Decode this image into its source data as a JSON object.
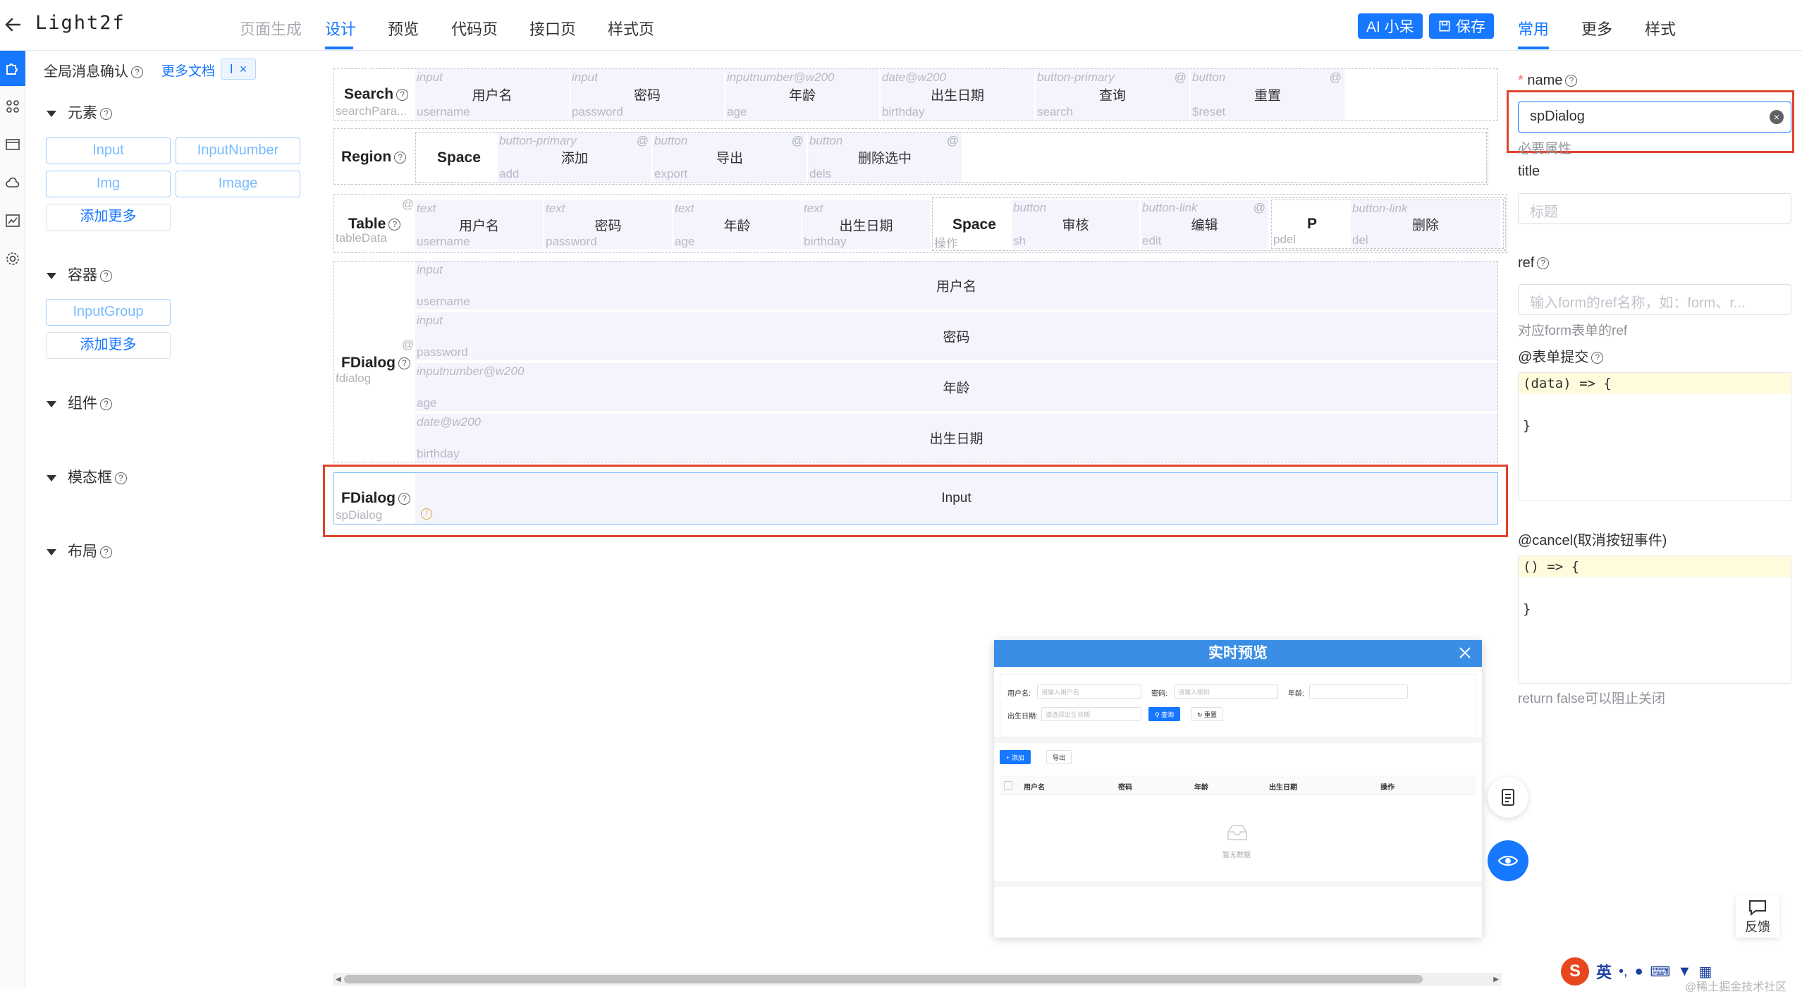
{
  "header": {
    "back_icon": "arrow-left-icon",
    "app_title": "Light2f",
    "tabs": [
      {
        "label": "页面生成",
        "state": "disabled"
      },
      {
        "label": "设计",
        "state": "active"
      },
      {
        "label": "预览",
        "state": "normal"
      },
      {
        "label": "代码页",
        "state": "normal"
      },
      {
        "label": "接口页",
        "state": "normal"
      },
      {
        "label": "样式页",
        "state": "normal"
      }
    ],
    "ai_button": "AI 小呆",
    "save_button": "保存",
    "accent_color": "#1677ff"
  },
  "left_panel": {
    "global_confirm": "全局消息确认",
    "more_docs": "更多文档",
    "tag_label": "I",
    "tag_close": "×",
    "sections": {
      "elements": {
        "title": "元素",
        "items": [
          "Input",
          "InputNumber",
          "Img",
          "Image"
        ],
        "add_more": "添加更多"
      },
      "containers": {
        "title": "容器",
        "items": [
          "InputGroup"
        ],
        "add_more": "添加更多"
      },
      "components": {
        "title": "组件"
      },
      "modals": {
        "title": "模态框"
      },
      "layout": {
        "title": "布局"
      }
    }
  },
  "canvas": {
    "search": {
      "label": "Search",
      "sub": "searchPara...",
      "cells": [
        {
          "tag": "input",
          "key": "username",
          "label": "用户名",
          "at": ""
        },
        {
          "tag": "input",
          "key": "password",
          "label": "密码",
          "at": ""
        },
        {
          "tag": "inputnumber@w200",
          "key": "age",
          "label": "年龄",
          "at": ""
        },
        {
          "tag": "date@w200",
          "key": "birthday",
          "label": "出生日期",
          "at": ""
        },
        {
          "tag": "button-primary",
          "key": "search",
          "label": "查询",
          "at": "@"
        },
        {
          "tag": "button",
          "key": "$reset",
          "label": "重置",
          "at": "@"
        }
      ]
    },
    "region": {
      "label": "Region",
      "space_label": "Space",
      "cells": [
        {
          "tag": "button-primary",
          "key": "add",
          "label": "添加",
          "at": "@"
        },
        {
          "tag": "button",
          "key": "export",
          "label": "导出",
          "at": "@"
        },
        {
          "tag": "button",
          "key": "dels",
          "label": "删除选中",
          "at": "@"
        }
      ]
    },
    "table": {
      "label": "Table",
      "sub": "tableData",
      "at": "@",
      "cells": [
        {
          "tag": "text",
          "key": "username",
          "label": "用户名"
        },
        {
          "tag": "text",
          "key": "password",
          "label": "密码"
        },
        {
          "tag": "text",
          "key": "age",
          "label": "年龄"
        },
        {
          "tag": "text",
          "key": "birthday",
          "label": "出生日期"
        }
      ],
      "space_label": "Space",
      "space_sub": "操作",
      "space_cells": [
        {
          "tag": "button",
          "key": "sh",
          "label": "审核",
          "at": ""
        },
        {
          "tag": "button-link",
          "key": "edit",
          "label": "编辑",
          "at": "@"
        }
      ],
      "p_label": "P",
      "p_sub": "pdel",
      "p_cells": [
        {
          "tag": "button-link",
          "key": "del",
          "label": "删除"
        }
      ]
    },
    "fdialog1": {
      "label": "FDialog",
      "sub": "fdialog",
      "at": "@",
      "rows": [
        {
          "tag": "input",
          "key": "username",
          "label": "用户名"
        },
        {
          "tag": "input",
          "key": "password",
          "label": "密码"
        },
        {
          "tag": "inputnumber@w200",
          "key": "age",
          "label": "年龄"
        },
        {
          "tag": "date@w200",
          "key": "birthday",
          "label": "出生日期"
        }
      ]
    },
    "fdialog2": {
      "label": "FDialog",
      "sub": "spDialog",
      "warn_icon": "warning-circle-icon",
      "content": "Input"
    }
  },
  "right_panel": {
    "tabs": [
      {
        "label": "常用",
        "state": "active"
      },
      {
        "label": "更多",
        "state": "normal"
      },
      {
        "label": "样式",
        "state": "normal"
      }
    ],
    "name": {
      "required_mark": "*",
      "label": "name",
      "value": "spDialog",
      "hint": "必要属性"
    },
    "title": {
      "label": "title",
      "placeholder": "标题"
    },
    "ref": {
      "label": "ref",
      "placeholder": "输入form的ref名称，如：form、r...",
      "hint": "对应form表单的ref"
    },
    "submit": {
      "label": "@表单提交",
      "code": [
        "(data) => {",
        "",
        "}"
      ]
    },
    "cancel": {
      "label": "@cancel(取消按钮事件)",
      "code": [
        "() => {",
        "",
        "}"
      ],
      "hint": "return false可以阻止关闭"
    }
  },
  "preview": {
    "title": "实时预览",
    "form": {
      "username_label": "用户名:",
      "username_ph": "请输入用户名",
      "password_label": "密码:",
      "password_ph": "请输入密码",
      "age_label": "年龄:",
      "birthday_label": "出生日期:",
      "birthday_ph": "请选择出生日期",
      "search_btn": "查询",
      "reset_btn": "重置"
    },
    "toolbar": {
      "add_btn": "+ 添加",
      "export_btn": "导出"
    },
    "table_headers": [
      "用户名",
      "密码",
      "年龄",
      "出生日期",
      "操作"
    ],
    "empty_text": "暂无数据"
  },
  "floating": {
    "doc_icon": "document-icon",
    "eye_icon": "eye-icon",
    "feedback_label": "反馈"
  },
  "ime_bar": {
    "lang": "英",
    "watermark": "@稀土掘金技术社区"
  }
}
